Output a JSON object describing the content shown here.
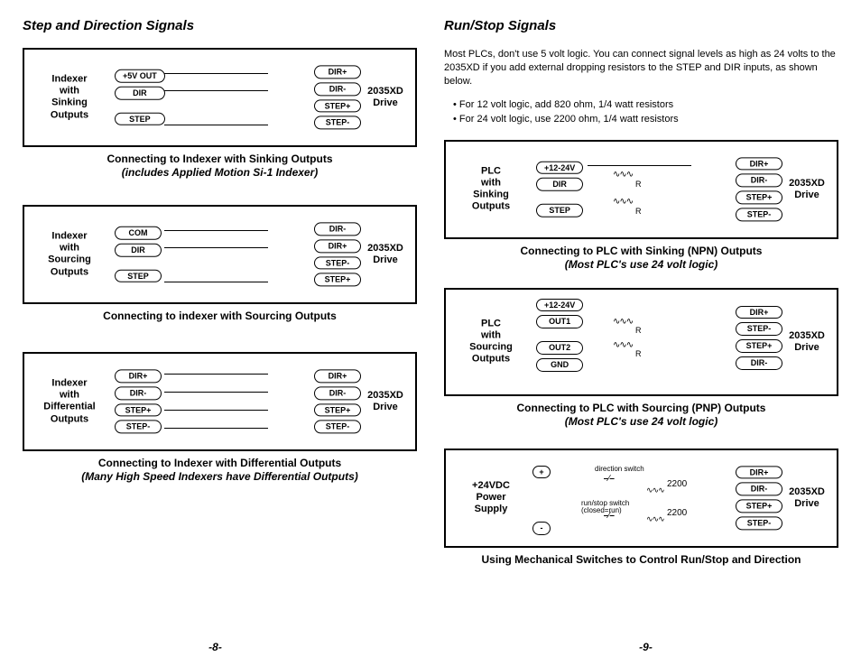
{
  "left": {
    "heading": "Step and Direction Signals",
    "diagrams": [
      {
        "leftLabel": "Indexer\nwith\nSinking\nOutputs",
        "rightLabel": "2035XD\nDrive",
        "leftTerms": [
          "+5V OUT",
          "DIR",
          "STEP"
        ],
        "rightTerms": [
          "DIR+",
          "DIR-",
          "STEP+",
          "STEP-"
        ],
        "caption": "Connecting to Indexer with Sinking Outputs",
        "sub": "(includes Applied Motion Si-1 Indexer)"
      },
      {
        "leftLabel": "Indexer\nwith\nSourcing\nOutputs",
        "rightLabel": "2035XD\nDrive",
        "leftTerms": [
          "COM",
          "DIR",
          "STEP"
        ],
        "rightTerms": [
          "DIR-",
          "DIR+",
          "STEP-",
          "STEP+"
        ],
        "caption": "Connecting to indexer with Sourcing Outputs"
      },
      {
        "leftLabel": "Indexer\nwith\nDifferential\nOutputs",
        "rightLabel": "2035XD\nDrive",
        "leftTerms": [
          "DIR+",
          "DIR-",
          "STEP+",
          "STEP-"
        ],
        "rightTerms": [
          "DIR+",
          "DIR-",
          "STEP+",
          "STEP-"
        ],
        "caption": "Connecting to Indexer with Differential Outputs",
        "sub": "(Many High Speed Indexers have Differential Outputs)"
      }
    ],
    "pageNum": "-8-"
  },
  "right": {
    "heading": "Run/Stop Signals",
    "intro": "Most PLCs, don't use 5 volt logic. You can connect signal levels as high as 24 volts to the 2035XD if you add external dropping resistors to the STEP and DIR inputs, as shown below.",
    "bullets": [
      "For 12 volt logic, add 820 ohm, 1/4 watt resistors",
      "For 24 volt logic, use 2200 ohm, 1/4 watt resistors"
    ],
    "diagrams": [
      {
        "leftLabel": "PLC\nwith\nSinking\nOutputs",
        "rightLabel": "2035XD\nDrive",
        "leftTerms": [
          "+12-24V",
          "DIR",
          "STEP"
        ],
        "rightTerms": [
          "DIR+",
          "DIR-",
          "STEP+",
          "STEP-"
        ],
        "rLabels": [
          "R",
          "R"
        ],
        "caption": "Connecting to PLC with Sinking (NPN) Outputs",
        "sub": "(Most PLC's use 24 volt logic)"
      },
      {
        "leftLabel": "PLC\nwith\nSourcing\nOutputs",
        "rightLabel": "2035XD\nDrive",
        "leftTerms": [
          "+12-24V",
          "OUT1",
          "OUT2",
          "GND"
        ],
        "rightTerms": [
          "DIR+",
          "STEP-",
          "STEP+",
          "DIR-"
        ],
        "rLabels": [
          "R",
          "R"
        ],
        "caption": "Connecting to PLC with Sourcing (PNP) Outputs",
        "sub": "(Most PLC's use 24 volt logic)"
      },
      {
        "leftLabel": "+24VDC\nPower\nSupply",
        "rightLabel": "2035XD\nDrive",
        "leftTerms": [
          "+",
          "-"
        ],
        "rightTerms": [
          "DIR+",
          "DIR-",
          "STEP+",
          "STEP-"
        ],
        "annots": [
          "direction switch",
          "run/stop switch\n(closed=run)"
        ],
        "resistors": [
          "2200",
          "2200"
        ],
        "caption": "Using Mechanical Switches to Control Run/Stop and Direction"
      }
    ],
    "pageNum": "-9-"
  }
}
